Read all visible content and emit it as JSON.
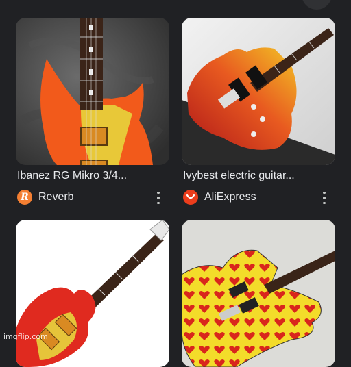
{
  "results": [
    {
      "title": "Ibanez RG Mikro 3/4...",
      "source": "Reverb",
      "source_logo_letter": "R",
      "source_color": "#f47f32",
      "image_icon": "orange-ibanez-guitar-image"
    },
    {
      "title": "Ivybest electric guitar...",
      "source": "AliExpress",
      "source_logo_letter": "",
      "source_color": "#ec3d1c",
      "image_icon": "red-gradient-guitar-image"
    },
    {
      "title": "",
      "source": "",
      "image_icon": "red-yellow-guitar-image"
    },
    {
      "title": "",
      "source": "",
      "image_icon": "hearts-pattern-guitar-image"
    }
  ],
  "watermark": "imgflip.com",
  "colors": {
    "background": "#202124",
    "text": "#e8eaed",
    "menu_dots": "#c4c7c5"
  }
}
